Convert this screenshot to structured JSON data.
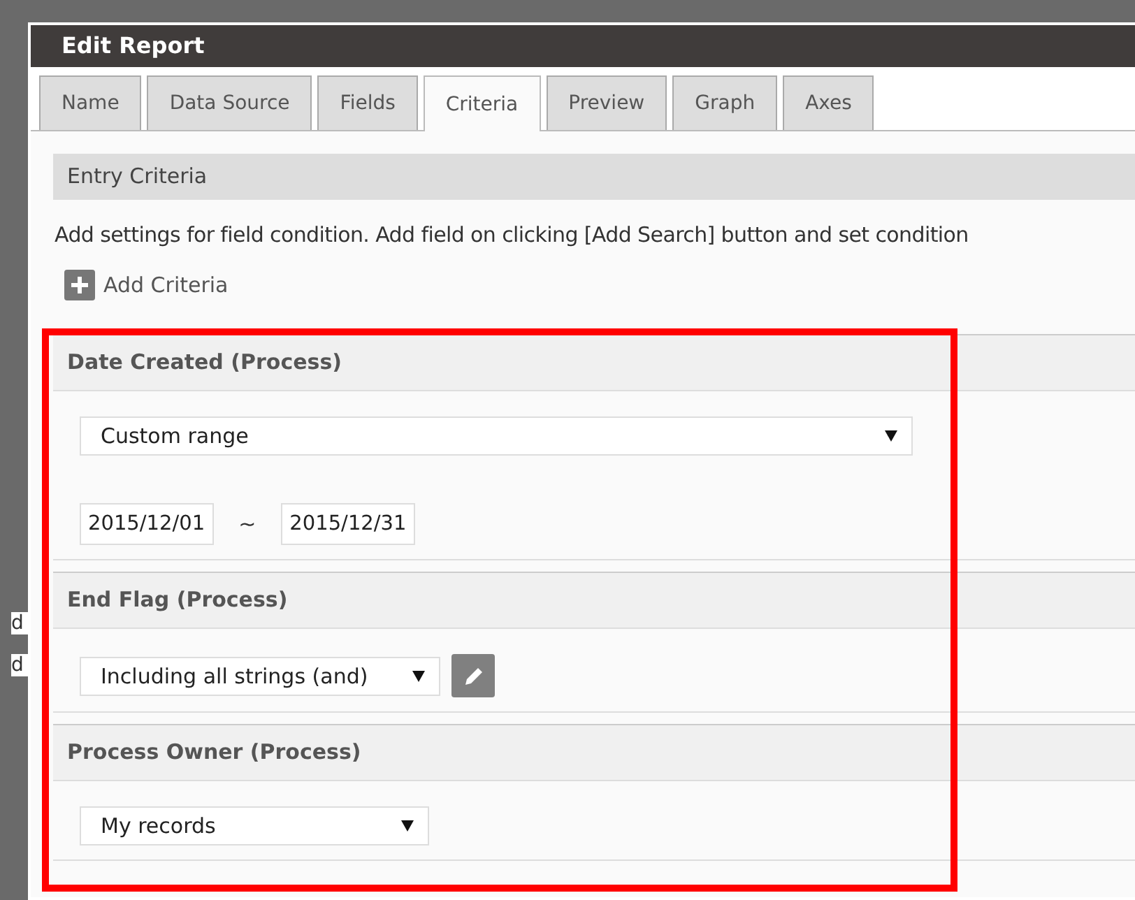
{
  "window": {
    "title": "Edit Report"
  },
  "background_texts": [
    "d",
    "d"
  ],
  "tabs": [
    {
      "label": "Name",
      "selected": false
    },
    {
      "label": "Data Source",
      "selected": false
    },
    {
      "label": "Fields",
      "selected": false
    },
    {
      "label": "Criteria",
      "selected": true
    },
    {
      "label": "Preview",
      "selected": false
    },
    {
      "label": "Graph",
      "selected": false
    },
    {
      "label": "Axes",
      "selected": false
    }
  ],
  "section_title": "Entry Criteria",
  "description": "Add settings for field condition. Add field on clicking [Add Search] button and set condition",
  "add_button": "Add Criteria",
  "criteria": [
    {
      "kind": "date_range",
      "title": "Date Created (Process)",
      "select": "Custom range",
      "from": "2015/12/01",
      "separator": "~",
      "to": "2015/12/31"
    },
    {
      "kind": "select_edit",
      "title": "End Flag (Process)",
      "select": "Including all strings (and)"
    },
    {
      "kind": "select",
      "title": "Process Owner (Process)",
      "select": "My records"
    }
  ],
  "highlight": true
}
